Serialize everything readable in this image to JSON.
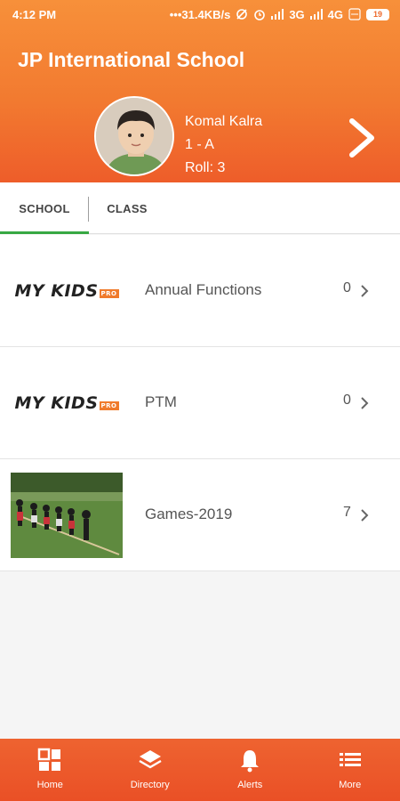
{
  "status_bar": {
    "time": "4:12 PM",
    "net_speed": "•••31.4KB/s",
    "net_3g": "3G",
    "net_4g": "4G",
    "battery": "19"
  },
  "header": {
    "school_name": "JP International School",
    "student_name": "Komal Kalra",
    "class_section": "1 - A",
    "roll": "Roll: 3"
  },
  "tabs": [
    {
      "label": "SCHOOL",
      "active": true
    },
    {
      "label": "CLASS",
      "active": false
    }
  ],
  "albums": [
    {
      "title": "Annual Functions",
      "count": "0",
      "thumb": "mykids-logo"
    },
    {
      "title": "PTM",
      "count": "0",
      "thumb": "mykids-logo"
    },
    {
      "title": "Games-2019",
      "count": "7",
      "thumb": "tug-of-war-photo"
    }
  ],
  "logo": {
    "text": "MY KIDS",
    "badge": "PRO"
  },
  "bottom_nav": [
    {
      "label": "Home",
      "icon": "grid-icon"
    },
    {
      "label": "Directory",
      "icon": "layers-icon"
    },
    {
      "label": "Alerts",
      "icon": "bell-icon"
    },
    {
      "label": "More",
      "icon": "list-icon"
    }
  ],
  "colors": {
    "header": "#f27a30",
    "tab_indicator": "#37a843",
    "bottom_nav": "#ec5a2b"
  }
}
